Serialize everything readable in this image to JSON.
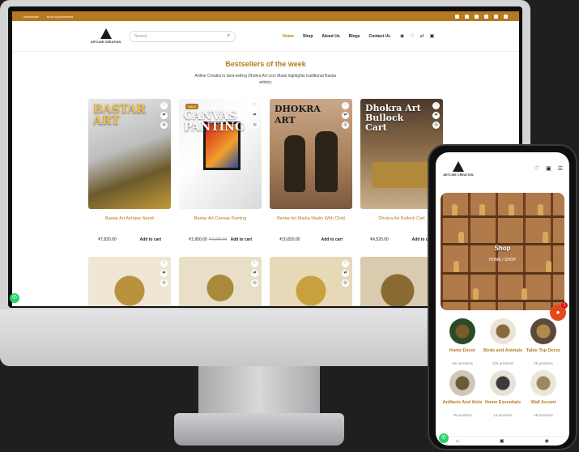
{
  "desktop": {
    "topbar": {
      "links": [
        "Wholesale",
        "Book Appointment"
      ]
    },
    "header": {
      "logo_text": "ARTLINE CREATION",
      "search_placeholder": "Search",
      "nav": [
        "Home",
        "Shop",
        "About Us",
        "Blogs",
        "Contact Us"
      ],
      "active_nav": "Home"
    },
    "section": {
      "title": "Bestsellers of the week",
      "subtitle": "Artline Creation's best-selling Dhokra Art Lion Mask highlights traditional Bastar artistry."
    },
    "products": [
      {
        "name": "Bastar Art Antique Nandi",
        "price": "₹7,820.00",
        "old_price": "",
        "add_to_cart": "Add to cart",
        "overlay": "BASTAR ART",
        "sale": ""
      },
      {
        "name": "Bastar Art Canvas Panting",
        "price": "₹1,950.00",
        "old_price": "₹2,999.00",
        "add_to_cart": "Add to cart",
        "overlay": "CANVAS PANTING",
        "sale": "SALE"
      },
      {
        "name": "Bastar Art Madia Madin With Child",
        "price": "₹10,820.00",
        "old_price": "",
        "add_to_cart": "Add to cart",
        "overlay": "DHOKRA ART",
        "sale": ""
      },
      {
        "name": "Dhokra Art Bullock Cart",
        "price": "₹4,520.00",
        "old_price": "",
        "add_to_cart": "Add to cart",
        "overlay": "Dhokra Art Bullock Cart",
        "sale": ""
      }
    ],
    "colors": {
      "accent": "#b7791f",
      "whatsapp": "#25d366"
    }
  },
  "mobile": {
    "logo_text": "ARTLINE CREATION",
    "hero_title": "Shop",
    "breadcrumb": "HOME  /  SHOP",
    "chat_badge": "1",
    "categories": [
      {
        "name": "Home Decor",
        "count": "161 products"
      },
      {
        "name": "Birds and Animals",
        "count": "126 products"
      },
      {
        "name": "Table Top Decor",
        "count": "45 products"
      },
      {
        "name": "Artifacts And Idols",
        "count": "79 products"
      },
      {
        "name": "Home Essentials",
        "count": "13 products"
      },
      {
        "name": "Wall Accent",
        "count": "28 products"
      }
    ]
  }
}
